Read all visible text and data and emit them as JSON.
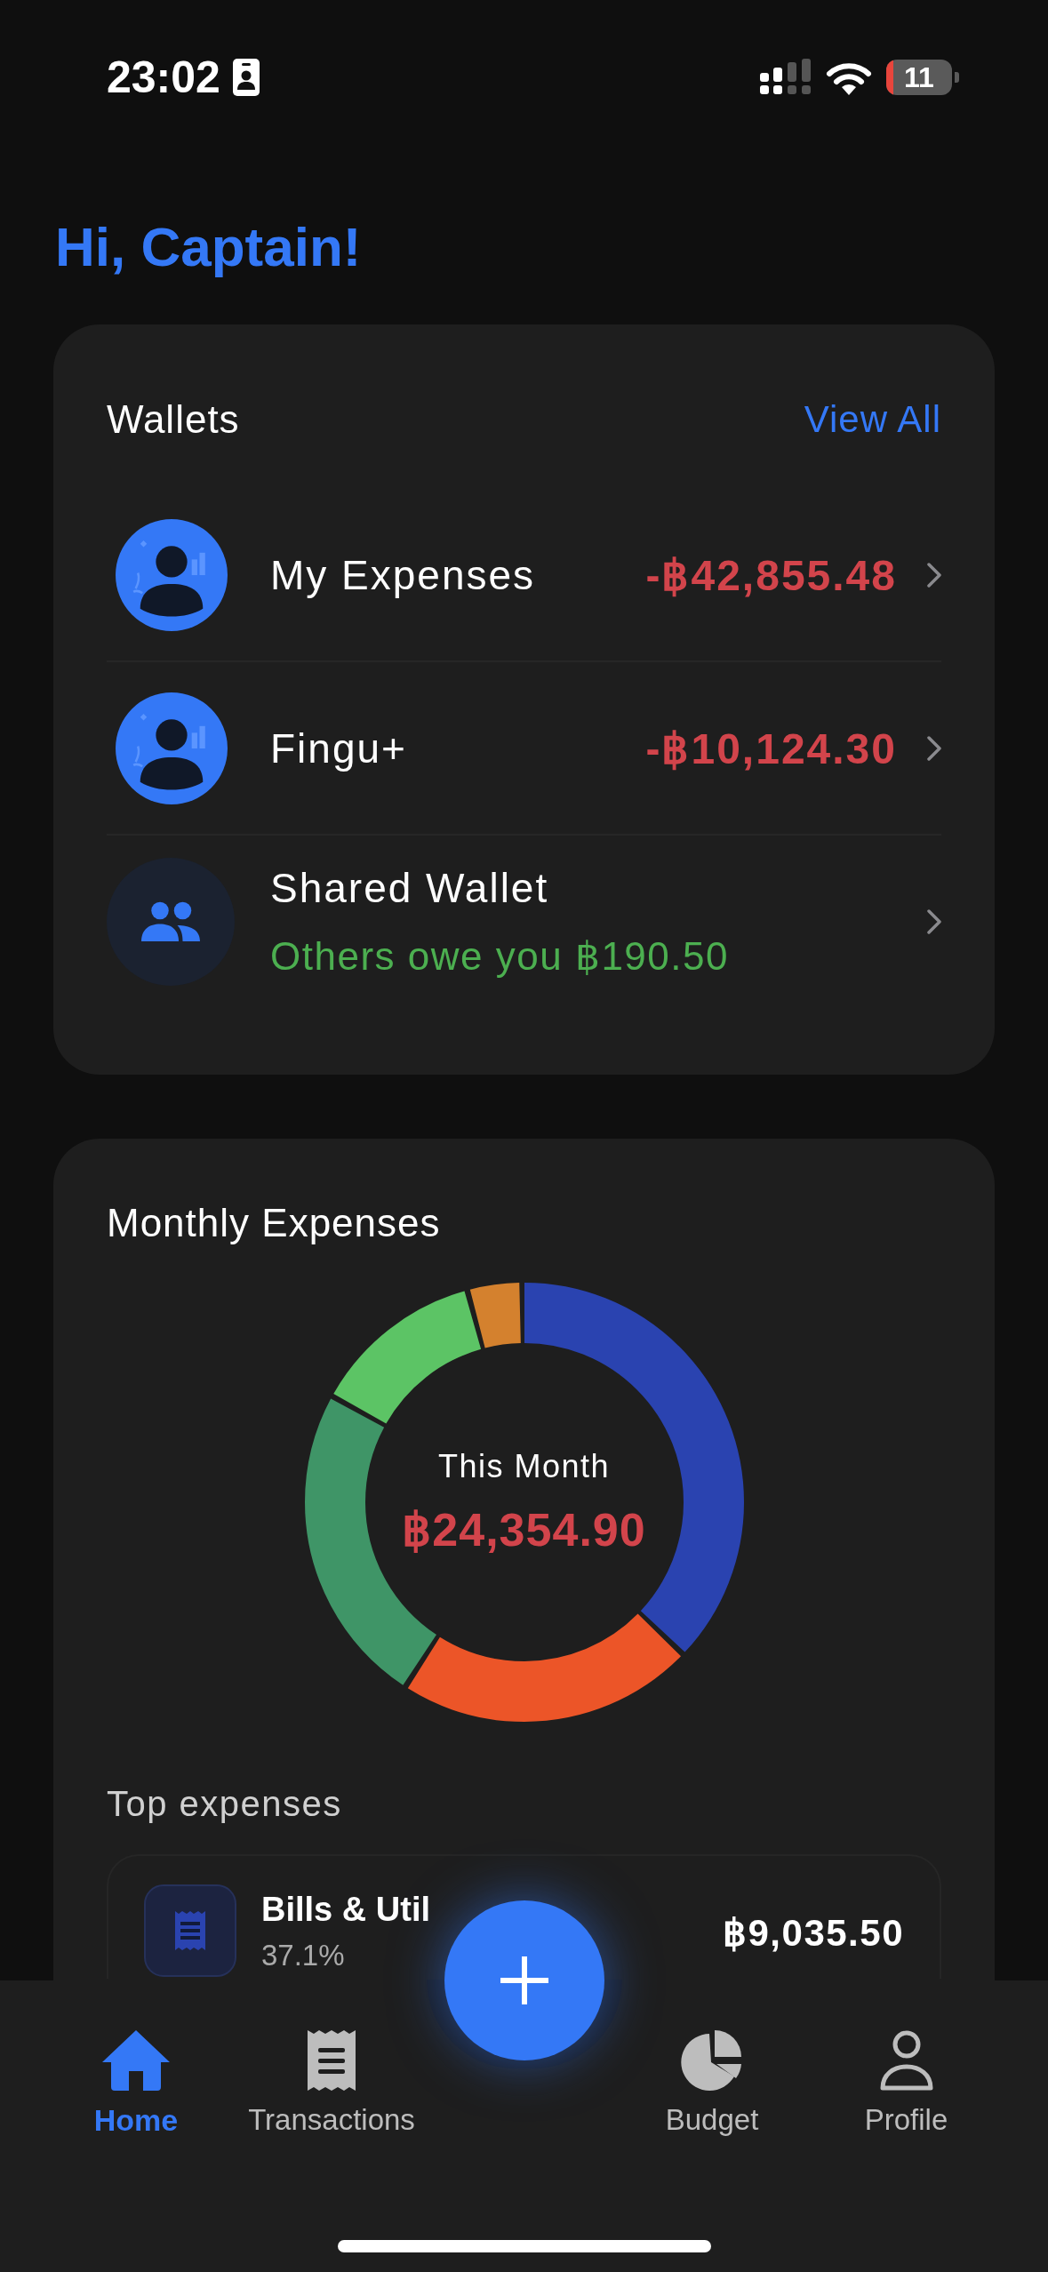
{
  "status_bar": {
    "time": "23:02",
    "battery": "11"
  },
  "greeting": "Hi, Captain!",
  "wallets": {
    "title": "Wallets",
    "view_all": "View All",
    "items": [
      {
        "kind": "personal",
        "name": "My Expenses",
        "amount": "-฿42,855.48"
      },
      {
        "kind": "personal",
        "name": "Fingu+",
        "amount": "-฿10,124.30"
      },
      {
        "kind": "shared",
        "name": "Shared Wallet",
        "note": "Others owe you ฿190.50"
      }
    ]
  },
  "monthly": {
    "title": "Monthly Expenses",
    "center_label": "This Month",
    "center_amount": "฿24,354.90",
    "top_title": "Top expenses",
    "top": [
      {
        "name": "Bills & Util",
        "share": "37.1%",
        "amount": "฿9,035.50"
      }
    ]
  },
  "tab_bar": {
    "tabs": [
      {
        "kind": "home",
        "label": "Home",
        "selected": true
      },
      {
        "kind": "transactions",
        "label": "Transactions",
        "selected": false
      },
      {
        "kind": "budget",
        "label": "Budget",
        "selected": false
      },
      {
        "kind": "profile",
        "label": "Profile",
        "selected": false
      }
    ]
  }
}
